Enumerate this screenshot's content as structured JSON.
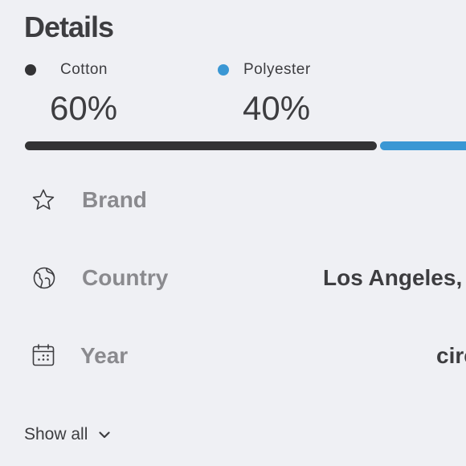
{
  "header": {
    "title": "Details"
  },
  "composition": [
    {
      "label": "Cotton",
      "percent_text": "60%",
      "percent": 60,
      "color": "#333335"
    },
    {
      "label": "Polyester",
      "percent_text": "40%",
      "percent": 40,
      "color": "#3a97d4"
    }
  ],
  "details": {
    "rows": [
      {
        "icon": "star-icon",
        "label": "Brand",
        "value": ""
      },
      {
        "icon": "globe-icon",
        "label": "Country",
        "value": "Los Angeles,"
      },
      {
        "icon": "calendar-icon",
        "label": "Year",
        "value": "circ"
      }
    ]
  },
  "footer": {
    "show_all_label": "Show all",
    "show_all_icon": "chevron-down-icon"
  }
}
